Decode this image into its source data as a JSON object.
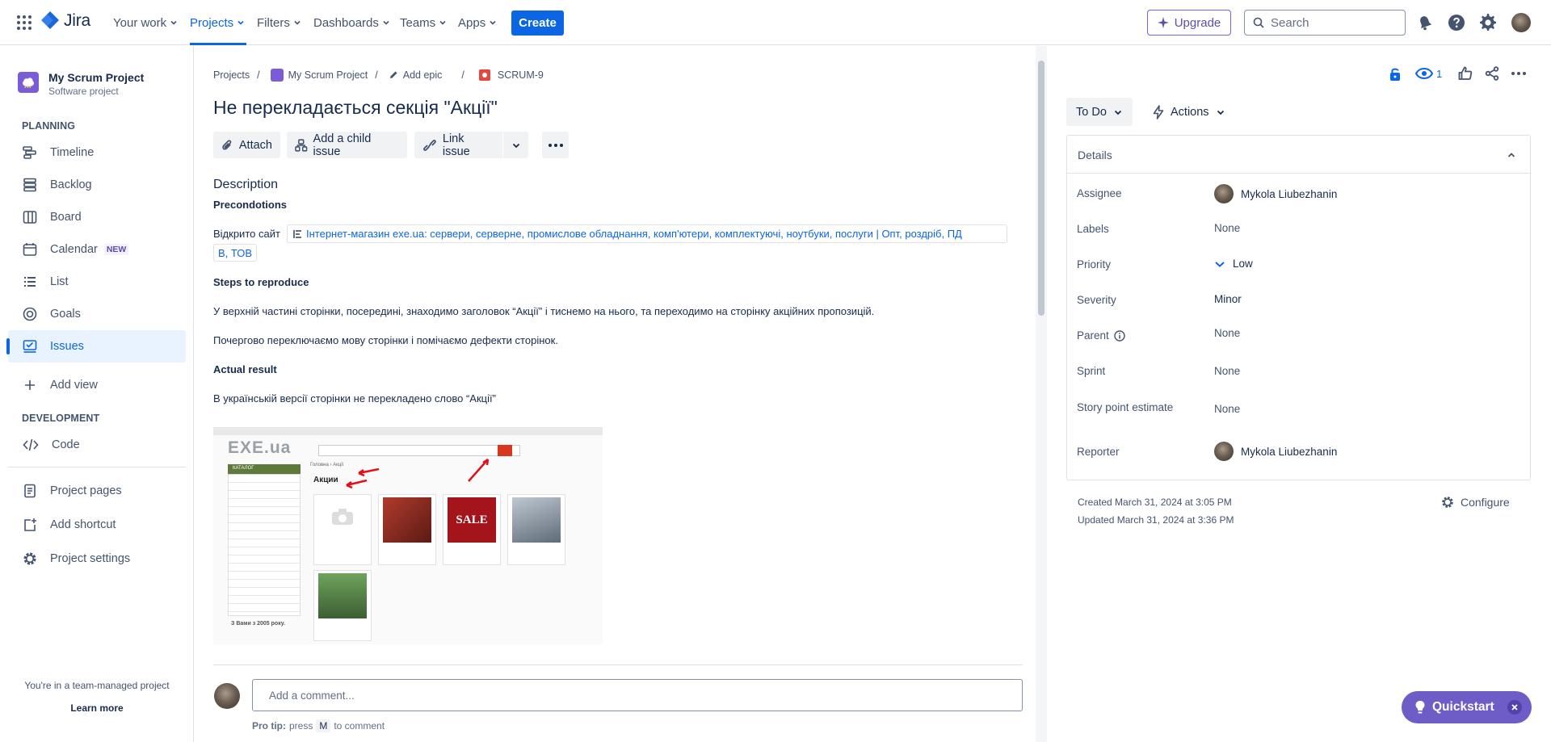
{
  "topnav": {
    "logo": "Jira",
    "items": [
      {
        "label": "Your work"
      },
      {
        "label": "Projects"
      },
      {
        "label": "Filters"
      },
      {
        "label": "Dashboards"
      },
      {
        "label": "Teams"
      },
      {
        "label": "Apps"
      }
    ],
    "create_label": "Create",
    "upgrade_label": "Upgrade",
    "search_placeholder": "Search",
    "accent": "#0c66e4"
  },
  "sidebar": {
    "project_name": "My Scrum Project",
    "project_type": "Software project",
    "planning_heading": "PLANNING",
    "planning_items": [
      {
        "label": "Timeline",
        "icon": "timeline-icon"
      },
      {
        "label": "Backlog",
        "icon": "backlog-icon"
      },
      {
        "label": "Board",
        "icon": "board-icon"
      },
      {
        "label": "Calendar",
        "icon": "calendar-icon",
        "badge": "NEW"
      },
      {
        "label": "List",
        "icon": "list-icon"
      },
      {
        "label": "Goals",
        "icon": "goals-icon"
      },
      {
        "label": "Issues",
        "icon": "issues-icon",
        "active": true
      }
    ],
    "add_view": "Add view",
    "development_heading": "DEVELOPMENT",
    "code": "Code",
    "project_pages": "Project pages",
    "add_shortcut": "Add shortcut",
    "project_settings": "Project settings",
    "footer_text": "You're in a team-managed project",
    "learn_more": "Learn more"
  },
  "breadcrumb": {
    "projects": "Projects",
    "project": "My Scrum Project",
    "add_epic": "Add epic",
    "issue_key": "SCRUM-9"
  },
  "issue": {
    "title": "Не перекладається секція \"Акції\"",
    "toolbar": {
      "attach": "Attach",
      "add_child": "Add a child issue",
      "link_issue": "Link issue"
    },
    "description_heading": "Description",
    "preconditions_heading": "Precondotions",
    "precondition_text": "Відкрито сайт",
    "link_text_line1": "Інтернет-магазин exe.ua: сервери, серверне, промислове обладнання, комп'ютери, комплектуючі, ноутбуки, послуги | Опт, роздріб, ПД",
    "link_text_line2": "В, ТОВ",
    "steps_heading": "Steps to reproduce",
    "step1": "У верхній частині сторінки, посередині, знаходимо заголовок “Акції” і тиснемо на нього, та переходимо на сторінку акційних пропозицій.",
    "step2": "Почергово переключаємо мову сторінки і помічаємо дефекти сторінок.",
    "actual_heading": "Actual result",
    "actual_text": "В українській версії сторінки не перекладено слово “Акції”",
    "screenshot": {
      "logo_text": "EXE.ua",
      "catalog_label": "КАТАЛОГ",
      "crumb_text": "Головна › Акції",
      "heading": "Акции",
      "sale_text": "SALE",
      "since_text": "З Вами з 2005 року."
    },
    "comment_placeholder": "Add a comment...",
    "pro_tip_label": "Pro tip:",
    "pro_tip_press": "press",
    "pro_tip_key": "M",
    "pro_tip_end": "to comment"
  },
  "right_panel": {
    "watchers_count": "1",
    "status": "To Do",
    "actions": "Actions",
    "details_heading": "Details",
    "fields": {
      "assignee_label": "Assignee",
      "assignee": "Mykola Liubezhanin",
      "labels_label": "Labels",
      "labels": "None",
      "priority_label": "Priority",
      "priority": "Low",
      "severity_label": "Severity",
      "severity": "Minor",
      "parent_label": "Parent",
      "parent": "None",
      "sprint_label": "Sprint",
      "sprint": "None",
      "story_points_label": "Story point estimate",
      "story_points": "None",
      "reporter_label": "Reporter",
      "reporter": "Mykola Liubezhanin"
    },
    "created": "Created March 31, 2024 at 3:05 PM",
    "updated": "Updated March 31, 2024 at 3:36 PM",
    "configure": "Configure"
  },
  "quickstart": {
    "label": "Quickstart"
  }
}
